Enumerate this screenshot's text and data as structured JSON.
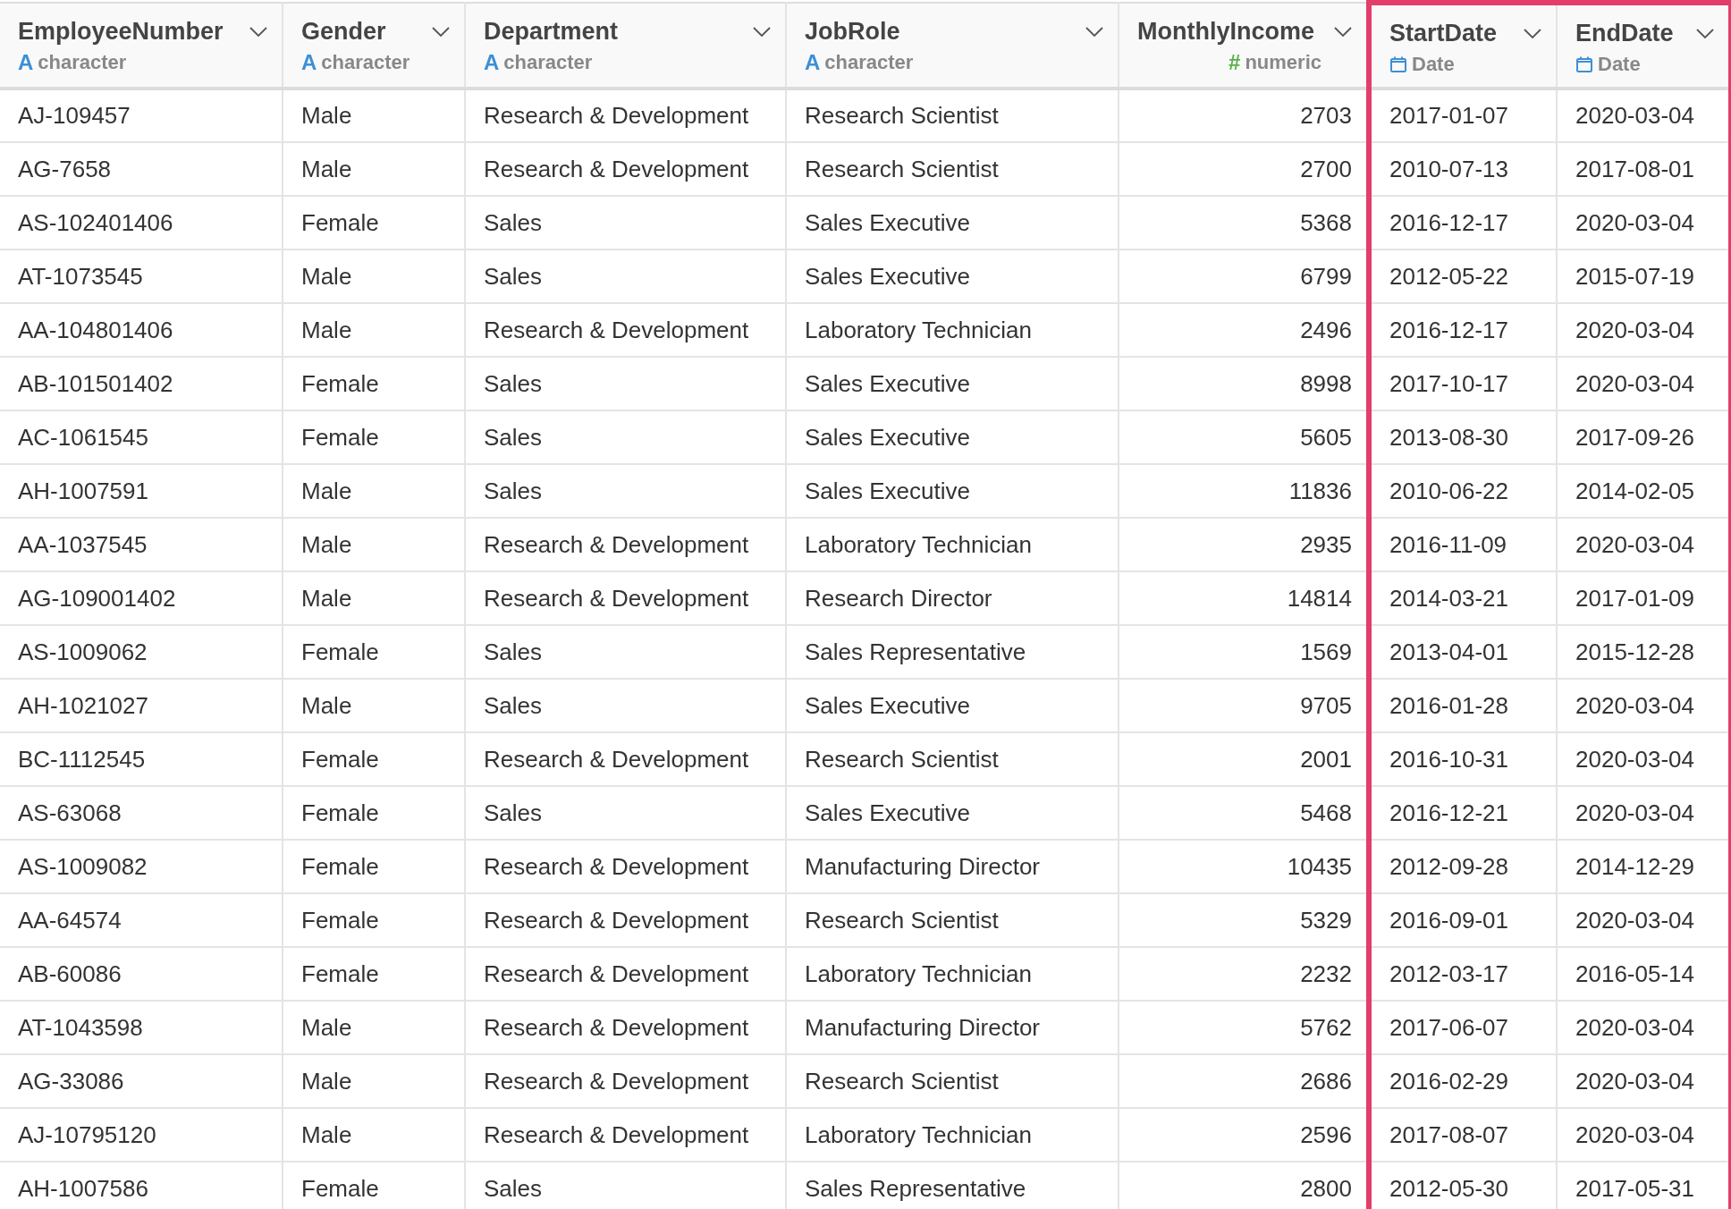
{
  "columns": [
    {
      "name": "EmployeeNumber",
      "kind": "character",
      "icon": "A",
      "type_label": "character",
      "highlighted": false
    },
    {
      "name": "Gender",
      "kind": "character",
      "icon": "A",
      "type_label": "character",
      "highlighted": false
    },
    {
      "name": "Department",
      "kind": "character",
      "icon": "A",
      "type_label": "character",
      "highlighted": false
    },
    {
      "name": "JobRole",
      "kind": "character",
      "icon": "A",
      "type_label": "character",
      "highlighted": false
    },
    {
      "name": "MonthlyIncome",
      "kind": "numeric",
      "icon": "#",
      "type_label": "numeric",
      "highlighted": false
    },
    {
      "name": "StartDate",
      "kind": "date",
      "type_label": "Date",
      "highlighted": true
    },
    {
      "name": "EndDate",
      "kind": "date",
      "type_label": "Date",
      "highlighted": true
    }
  ],
  "rows": [
    [
      "AJ-109457",
      "Male",
      "Research & Development",
      "Research Scientist",
      "2703",
      "2017-01-07",
      "2020-03-04"
    ],
    [
      "AG-7658",
      "Male",
      "Research & Development",
      "Research Scientist",
      "2700",
      "2010-07-13",
      "2017-08-01"
    ],
    [
      "AS-102401406",
      "Female",
      "Sales",
      "Sales Executive",
      "5368",
      "2016-12-17",
      "2020-03-04"
    ],
    [
      "AT-1073545",
      "Male",
      "Sales",
      "Sales Executive",
      "6799",
      "2012-05-22",
      "2015-07-19"
    ],
    [
      "AA-104801406",
      "Male",
      "Research & Development",
      "Laboratory Technician",
      "2496",
      "2016-12-17",
      "2020-03-04"
    ],
    [
      "AB-101501402",
      "Female",
      "Sales",
      "Sales Executive",
      "8998",
      "2017-10-17",
      "2020-03-04"
    ],
    [
      "AC-1061545",
      "Female",
      "Sales",
      "Sales Executive",
      "5605",
      "2013-08-30",
      "2017-09-26"
    ],
    [
      "AH-1007591",
      "Male",
      "Sales",
      "Sales Executive",
      "11836",
      "2010-06-22",
      "2014-02-05"
    ],
    [
      "AA-1037545",
      "Male",
      "Research & Development",
      "Laboratory Technician",
      "2935",
      "2016-11-09",
      "2020-03-04"
    ],
    [
      "AG-109001402",
      "Male",
      "Research & Development",
      "Research Director",
      "14814",
      "2014-03-21",
      "2017-01-09"
    ],
    [
      "AS-1009062",
      "Female",
      "Sales",
      "Sales Representative",
      "1569",
      "2013-04-01",
      "2015-12-28"
    ],
    [
      "AH-1021027",
      "Male",
      "Sales",
      "Sales Executive",
      "9705",
      "2016-01-28",
      "2020-03-04"
    ],
    [
      "BC-1112545",
      "Female",
      "Research & Development",
      "Research Scientist",
      "2001",
      "2016-10-31",
      "2020-03-04"
    ],
    [
      "AS-63068",
      "Female",
      "Sales",
      "Sales Executive",
      "5468",
      "2016-12-21",
      "2020-03-04"
    ],
    [
      "AS-1009082",
      "Female",
      "Research & Development",
      "Manufacturing Director",
      "10435",
      "2012-09-28",
      "2014-12-29"
    ],
    [
      "AA-64574",
      "Female",
      "Research & Development",
      "Research Scientist",
      "5329",
      "2016-09-01",
      "2020-03-04"
    ],
    [
      "AB-60086",
      "Female",
      "Research & Development",
      "Laboratory Technician",
      "2232",
      "2012-03-17",
      "2016-05-14"
    ],
    [
      "AT-1043598",
      "Male",
      "Research & Development",
      "Manufacturing Director",
      "5762",
      "2017-06-07",
      "2020-03-04"
    ],
    [
      "AG-33086",
      "Male",
      "Research & Development",
      "Research Scientist",
      "2686",
      "2016-02-29",
      "2020-03-04"
    ],
    [
      "AJ-10795120",
      "Male",
      "Research & Development",
      "Laboratory Technician",
      "2596",
      "2017-08-07",
      "2020-03-04"
    ],
    [
      "AH-1007586",
      "Female",
      "Sales",
      "Sales Representative",
      "2800",
      "2012-05-30",
      "2017-05-31"
    ]
  ]
}
